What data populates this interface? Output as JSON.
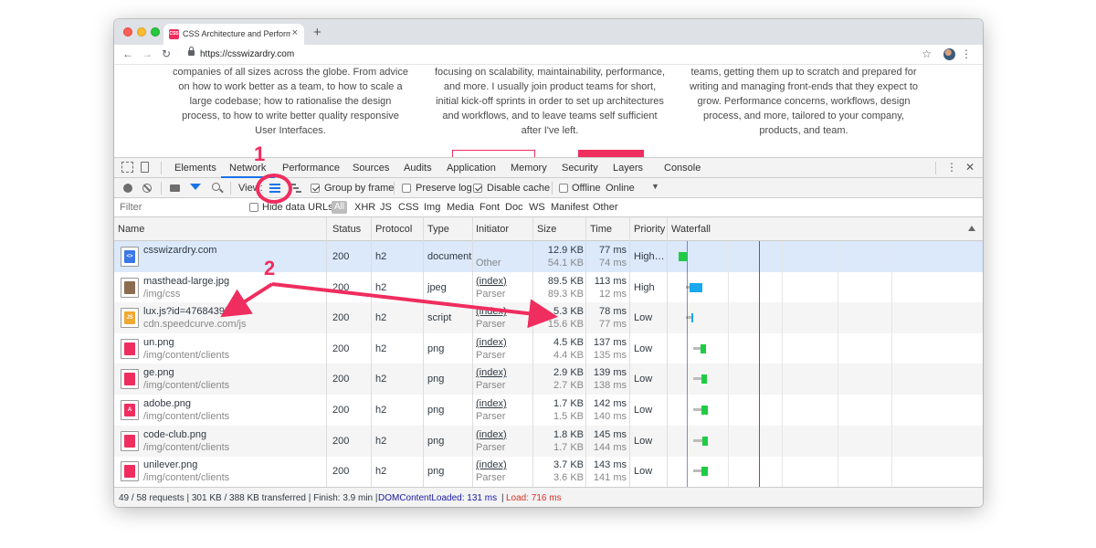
{
  "browser": {
    "tab_title": "CSS Architecture and Performa",
    "tab_close": "×",
    "new_tab": "+",
    "url": "https://csswizardry.com",
    "favicon_text": "CSS"
  },
  "page": {
    "col1": "companies of all sizes across the globe. From advice on how to work better as a team, to how to scale a large codebase; how to rationalise the design process, to how to write better quality responsive User Interfaces.",
    "col2": "focusing on scalability, maintainability, performance, and more. I usually join product teams for short, initial kick-off sprints in order to set up architectures and workflows, and to leave teams self sufficient after I've left.",
    "col3": "teams, getting them up to scratch and prepared for writing and managing front-ends that they expect to grow. Performance concerns, workflows, design process, and more, tailored to your company, products, and team.",
    "accent_color": "#ef2d5e"
  },
  "devtools": {
    "tabs": [
      "Elements",
      "Network",
      "Performance",
      "Sources",
      "Audits",
      "Application",
      "Memory",
      "Security",
      "Layers",
      "Console"
    ],
    "active_tab": "Network",
    "network_bar": {
      "view_label": "View:",
      "group_by_frame": "Group by frame",
      "preserve_log": "Preserve log",
      "disable_cache": "Disable cache",
      "offline": "Offline",
      "throttle": "Online"
    },
    "filter": {
      "placeholder": "Filter",
      "hide_data_urls": "Hide data URLs",
      "all": "All",
      "types": [
        "XHR",
        "JS",
        "CSS",
        "Img",
        "Media",
        "Font",
        "Doc",
        "WS",
        "Manifest",
        "Other"
      ]
    },
    "columns": {
      "name": "Name",
      "status": "Status",
      "protocol": "Protocol",
      "type": "Type",
      "initiator": "Initiator",
      "size": "Size",
      "time": "Time",
      "priority": "Priority",
      "waterfall": "Waterfall"
    },
    "rows": [
      {
        "name": "csswizardry.com",
        "path": "",
        "status": "200",
        "protocol": "h2",
        "type": "document",
        "initiator": "",
        "initiator_sub": "Other",
        "size1": "12.9 KB",
        "size2": "54.1 KB",
        "time1": "77 ms",
        "time2": "74 ms",
        "priority": "High…",
        "icon": "doc",
        "wf_color": "#1ecc44"
      },
      {
        "name": "masthead-large.jpg",
        "path": "/img/css",
        "status": "200",
        "protocol": "h2",
        "type": "jpeg",
        "initiator": "(index)",
        "initiator_sub": "Parser",
        "size1": "89.5 KB",
        "size2": "89.3 KB",
        "time1": "113 ms",
        "time2": "12 ms",
        "priority": "High",
        "icon": "img",
        "wf_color": "#19a7ee"
      },
      {
        "name": "lux.js?id=47684395",
        "path": "cdn.speedcurve.com/js",
        "status": "200",
        "protocol": "h2",
        "type": "script",
        "initiator": "(index)",
        "initiator_sub": "Parser",
        "size1": "5.3 KB",
        "size2": "15.6 KB",
        "time1": "78 ms",
        "time2": "77 ms",
        "priority": "Low",
        "icon": "js",
        "wf_color": "#19a7ee"
      },
      {
        "name": "un.png",
        "path": "/img/content/clients",
        "status": "200",
        "protocol": "h2",
        "type": "png",
        "initiator": "(index)",
        "initiator_sub": "Parser",
        "size1": "4.5 KB",
        "size2": "4.4 KB",
        "time1": "137 ms",
        "time2": "135 ms",
        "priority": "Low",
        "icon": "png",
        "wf_color": "#1ecc44"
      },
      {
        "name": "ge.png",
        "path": "/img/content/clients",
        "status": "200",
        "protocol": "h2",
        "type": "png",
        "initiator": "(index)",
        "initiator_sub": "Parser",
        "size1": "2.9 KB",
        "size2": "2.7 KB",
        "time1": "139 ms",
        "time2": "138 ms",
        "priority": "Low",
        "icon": "png",
        "wf_color": "#1ecc44"
      },
      {
        "name": "adobe.png",
        "path": "/img/content/clients",
        "status": "200",
        "protocol": "h2",
        "type": "png",
        "initiator": "(index)",
        "initiator_sub": "Parser",
        "size1": "1.7 KB",
        "size2": "1.5 KB",
        "time1": "142 ms",
        "time2": "140 ms",
        "priority": "Low",
        "icon": "adobe",
        "wf_color": "#1ecc44"
      },
      {
        "name": "code-club.png",
        "path": "/img/content/clients",
        "status": "200",
        "protocol": "h2",
        "type": "png",
        "initiator": "(index)",
        "initiator_sub": "Parser",
        "size1": "1.8 KB",
        "size2": "1.7 KB",
        "time1": "145 ms",
        "time2": "144 ms",
        "priority": "Low",
        "icon": "png",
        "wf_color": "#1ecc44"
      },
      {
        "name": "unilever.png",
        "path": "/img/content/clients",
        "status": "200",
        "protocol": "h2",
        "type": "png",
        "initiator": "(index)",
        "initiator_sub": "Parser",
        "size1": "3.7 KB",
        "size2": "3.6 KB",
        "time1": "143 ms",
        "time2": "141 ms",
        "priority": "Low",
        "icon": "png",
        "wf_color": "#1ecc44"
      }
    ],
    "status": {
      "summary": "49 / 58 requests | 301 KB / 388 KB transferred | Finish: 3.9 min |",
      "dcl": "DOMContentLoaded: 131 ms",
      "sep": "|",
      "load": "Load: 716 ms",
      "dcl_color": "#1a1aa6",
      "load_color": "#d93025"
    }
  },
  "annotations": {
    "label1": "1",
    "label2": "2",
    "color": "#ef2d5e"
  }
}
